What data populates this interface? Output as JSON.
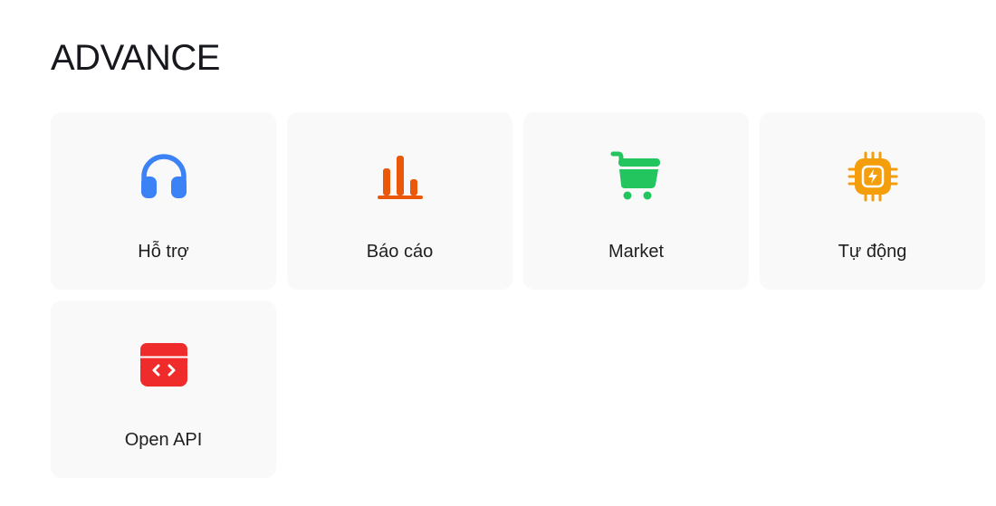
{
  "section": {
    "title": "ADVANCE"
  },
  "cards": [
    {
      "label": "Hỗ trợ",
      "icon": "headphones-icon",
      "color": "#3b82f6"
    },
    {
      "label": "Báo cáo",
      "icon": "bar-chart-icon",
      "color": "#ea580c"
    },
    {
      "label": "Market",
      "icon": "shopping-cart-icon",
      "color": "#22c55e"
    },
    {
      "label": "Tự động",
      "icon": "cpu-chip-icon",
      "color": "#f59e0b"
    },
    {
      "label": "Open API",
      "icon": "code-window-icon",
      "color": "#ef2b2b"
    }
  ]
}
